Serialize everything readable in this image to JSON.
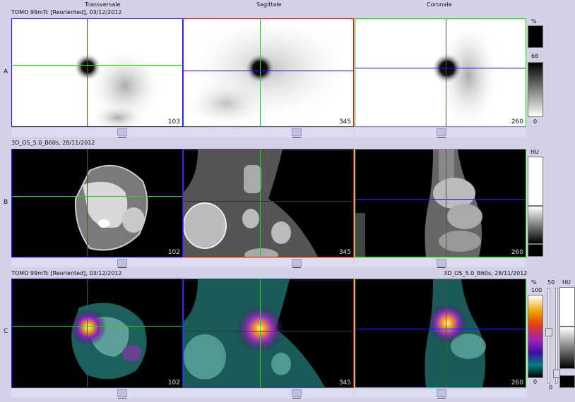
{
  "header": {
    "col_transversale": "Transversale",
    "col_sagittale": "Sagittale",
    "col_coronale": "Coronale",
    "row_a_series": "TOMO 99mTc [Reoriented], 03/12/2012",
    "row_b_series": "3D_OS_5.0_B60s, 28/11/2012",
    "row_c_series_left": "TOMO 99mTc [Reoriented], 03/12/2012",
    "row_c_series_right": "3D_OS_5.0_B60s, 28/11/2012"
  },
  "rows": {
    "a": {
      "label": "A",
      "slices": [
        "103",
        "345",
        "260"
      ]
    },
    "b": {
      "label": "B",
      "slices": [
        "102",
        "345",
        "260"
      ]
    },
    "c": {
      "label": "C",
      "slices": [
        "102",
        "345",
        "260"
      ]
    }
  },
  "colorbars": {
    "a": {
      "unit": "%",
      "value": "68",
      "min": "0"
    },
    "b": {
      "unit": "HU"
    },
    "c": {
      "unit_pct": "%",
      "unit_hu": "HU",
      "max": "100",
      "mid": "50",
      "min": "0",
      "min2": "0"
    }
  },
  "colors": {
    "crosshair_red": "#c02020",
    "crosshair_green": "#40c040",
    "crosshair_blue": "#2020c0",
    "background": "#d4d0e8"
  }
}
